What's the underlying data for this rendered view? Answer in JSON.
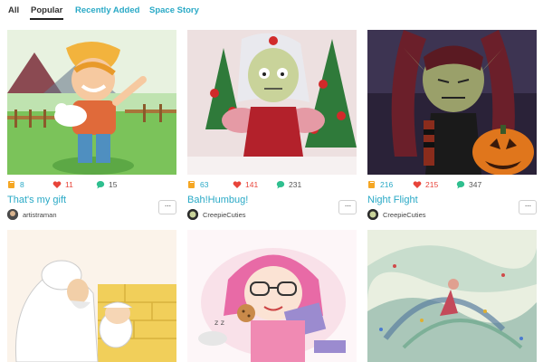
{
  "tabs": [
    {
      "label": "All"
    },
    {
      "label": "Popular"
    },
    {
      "label": "Recently Added"
    },
    {
      "label": "Space Story"
    }
  ],
  "colors": {
    "accent": "#29a9c6",
    "like": "#e8443a",
    "comment": "#2fbf8f",
    "book": "#f5a623"
  },
  "cards": [
    {
      "title": "That's my gift",
      "author": "artistraman",
      "reads": "8",
      "likes": "11",
      "comments": "15",
      "more_label": "···"
    },
    {
      "title": "Bah!Humbug!",
      "author": "CreepieCuties",
      "reads": "63",
      "likes": "141",
      "comments": "231",
      "more_label": "···"
    },
    {
      "title": "Night Flight",
      "author": "CreepieCuties",
      "reads": "216",
      "likes": "215",
      "comments": "347",
      "more_label": "···"
    }
  ],
  "icons": {
    "reads": "book-icon",
    "likes": "heart-icon",
    "comments": "speech-bubble-icon",
    "more": "ellipsis-icon"
  }
}
